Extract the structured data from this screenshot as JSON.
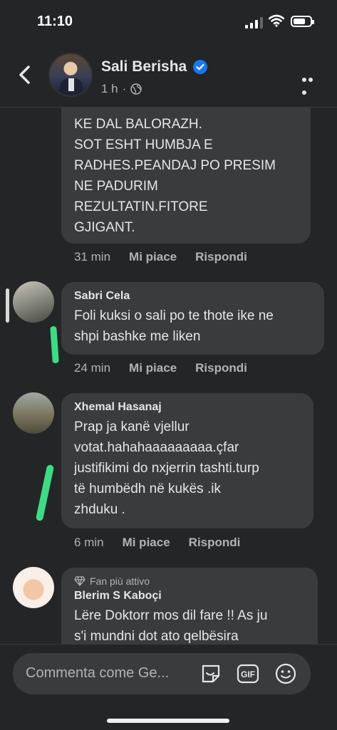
{
  "status_bar": {
    "time": "11:10"
  },
  "header": {
    "name": "Sali Berisha",
    "time_ago": "1 h",
    "separator": "·"
  },
  "comments": [
    {
      "lines": [
        "KE DAL BALORAZH.",
        "SOT ESHT HUMBJA E",
        "RADHES.PEANDAJ PO PRESIM",
        "NE PADURIM",
        "REZULTATIN.FITORE",
        "GJIGANT."
      ],
      "time": "31 min",
      "like": "Mi piace",
      "reply": "Rispondi"
    },
    {
      "author": "Sabri Cela",
      "lines": [
        "Foli kuksi o sali po te thote ike ne",
        "shpi bashke me liken"
      ],
      "time": "24 min",
      "like": "Mi piace",
      "reply": "Rispondi"
    },
    {
      "author": "Xhemal Hasanaj",
      "lines": [
        "Prap ja kanë vjellur",
        "votat.hahahaaaaaaaaa.çfar",
        "justifikimi do nxjerrin tashti.turp",
        "të humbëdh në kukës .ik",
        "zhduku ."
      ],
      "time": "6 min",
      "like": "Mi piace",
      "reply": "Rispondi"
    },
    {
      "badge": "Fan più attivo",
      "author": "Blerim S Kaboçi",
      "lines": [
        "Lëre Doktorr mos dil fare !! As ju",
        "s'i mundni dot ato qelbësira"
      ]
    }
  ],
  "composer": {
    "placeholder": "Commenta come Ge..."
  },
  "colors": {
    "background": "#242526",
    "bubble": "#3a3b3c",
    "verified": "#1877f2",
    "marker": "#3ddc84"
  }
}
